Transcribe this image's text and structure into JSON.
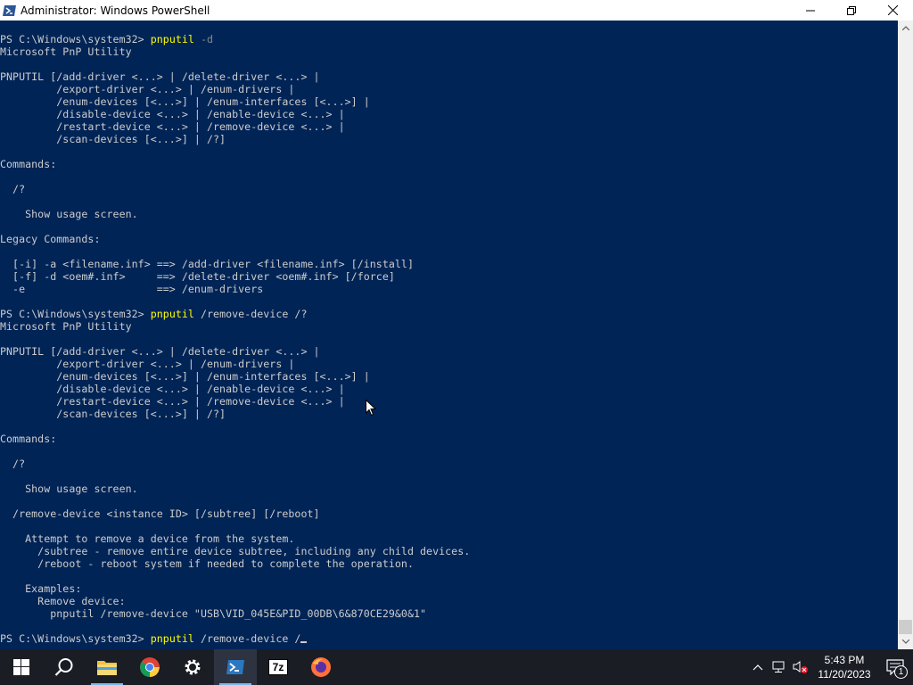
{
  "window": {
    "title": "Administrator: Windows PowerShell"
  },
  "console": {
    "lines": [
      {
        "prompt": "PS C:\\Windows\\system32> ",
        "cmd": "pnputil",
        "args": " -d",
        "argsStyle": "gray"
      },
      {
        "text": "Microsoft PnP Utility"
      },
      {
        "text": ""
      },
      {
        "text": "PNPUTIL [/add-driver <...> | /delete-driver <...> |"
      },
      {
        "text": "         /export-driver <...> | /enum-drivers |"
      },
      {
        "text": "         /enum-devices [<...>] | /enum-interfaces [<...>] |"
      },
      {
        "text": "         /disable-device <...> | /enable-device <...> |"
      },
      {
        "text": "         /restart-device <...> | /remove-device <...> |"
      },
      {
        "text": "         /scan-devices [<...>] | /?]"
      },
      {
        "text": ""
      },
      {
        "text": "Commands:"
      },
      {
        "text": ""
      },
      {
        "text": "  /?"
      },
      {
        "text": ""
      },
      {
        "text": "    Show usage screen."
      },
      {
        "text": ""
      },
      {
        "text": "Legacy Commands:"
      },
      {
        "text": ""
      },
      {
        "text": "  [-i] -a <filename.inf> ==> /add-driver <filename.inf> [/install]"
      },
      {
        "text": "  [-f] -d <oem#.inf>     ==> /delete-driver <oem#.inf> [/force]"
      },
      {
        "text": "  -e                     ==> /enum-drivers"
      },
      {
        "text": ""
      },
      {
        "prompt": "PS C:\\Windows\\system32> ",
        "cmd": "pnputil",
        "args": " /remove-device /?",
        "argsStyle": "white"
      },
      {
        "text": "Microsoft PnP Utility"
      },
      {
        "text": ""
      },
      {
        "text": "PNPUTIL [/add-driver <...> | /delete-driver <...> |"
      },
      {
        "text": "         /export-driver <...> | /enum-drivers |"
      },
      {
        "text": "         /enum-devices [<...>] | /enum-interfaces [<...>] |"
      },
      {
        "text": "         /disable-device <...> | /enable-device <...> |"
      },
      {
        "text": "         /restart-device <...> | /remove-device <...> |"
      },
      {
        "text": "         /scan-devices [<...>] | /?]"
      },
      {
        "text": ""
      },
      {
        "text": "Commands:"
      },
      {
        "text": ""
      },
      {
        "text": "  /?"
      },
      {
        "text": ""
      },
      {
        "text": "    Show usage screen."
      },
      {
        "text": ""
      },
      {
        "text": "  /remove-device <instance ID> [/subtree] [/reboot]"
      },
      {
        "text": ""
      },
      {
        "text": "    Attempt to remove a device from the system."
      },
      {
        "text": "      /subtree - remove entire device subtree, including any child devices."
      },
      {
        "text": "      /reboot - reboot system if needed to complete the operation."
      },
      {
        "text": ""
      },
      {
        "text": "    Examples:"
      },
      {
        "text": "      Remove device:"
      },
      {
        "text": "        pnputil /remove-device \"USB\\VID_045E&PID_00DB\\6&870CE29&0&1\""
      },
      {
        "text": ""
      },
      {
        "prompt": "PS C:\\Windows\\system32> ",
        "cmd": "pnputil",
        "args": " /remove-device /",
        "argsStyle": "white",
        "cursor": true
      }
    ]
  },
  "taskbar": {
    "items": [
      "start",
      "search",
      "file-explorer",
      "chrome",
      "settings",
      "powershell",
      "7zip",
      "firefox"
    ],
    "sevenzip_label": "7z",
    "clock_time": "5:43 PM",
    "clock_date": "11/20/2023",
    "notification_count": "1"
  },
  "colors": {
    "console_bg": "#012456",
    "console_text": "#cccccc",
    "command": "#ffff00",
    "param": "#8a8a8a",
    "taskbar_bg": "#1a1d24"
  }
}
